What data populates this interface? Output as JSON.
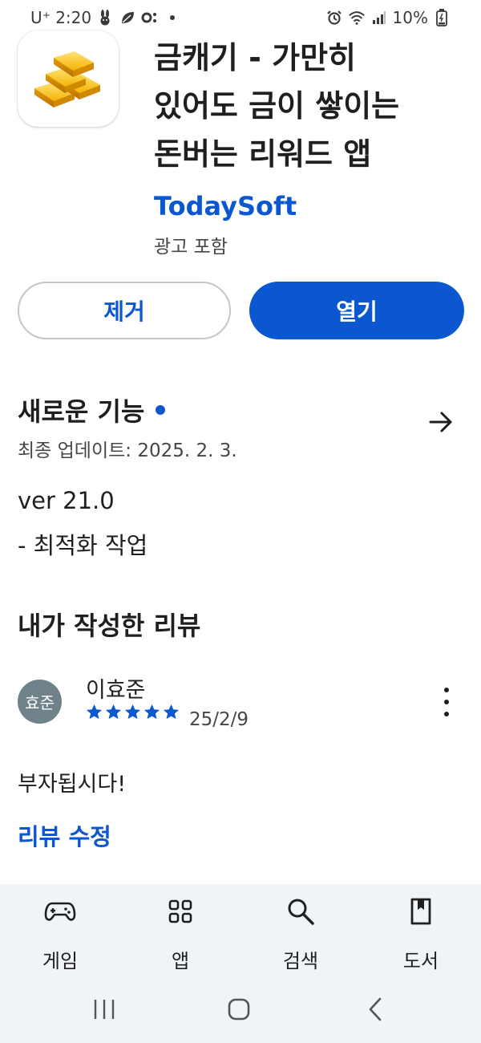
{
  "status_bar": {
    "carrier": "U⁺",
    "time": "2:20",
    "battery": "10%",
    "icons_left": [
      "rabbit-icon",
      "leaf-icon",
      "oo-icon",
      "dot-icon"
    ],
    "icons_right": [
      "alarm-icon",
      "wifi-icon",
      "signal-icon",
      "battery-icon"
    ]
  },
  "app": {
    "icon": "gold-bars-icon",
    "title_lines": [
      "금캐기 - 가만히",
      "있어도 금이 쌓이는",
      "돈버는 리워드 앱"
    ],
    "developer": "TodaySoft",
    "ads_notice": "광고 포함"
  },
  "actions": {
    "remove_label": "제거",
    "open_label": "열기"
  },
  "whats_new": {
    "title": "새로운 기능",
    "last_updated": "최종 업데이트: 2025. 2. 3.",
    "version": "ver 21.0",
    "note": "- 최적화 작업"
  },
  "my_review": {
    "section_title": "내가 작성한 리뷰",
    "avatar_text": "효준",
    "reviewer_name": "이효준",
    "rating": 5,
    "max_rating": 5,
    "date": "25/2/9",
    "text": "부자됩시다!",
    "edit_label": "리뷰 수정"
  },
  "bottom_nav": {
    "items": [
      {
        "label": "게임",
        "icon": "gamepad-icon"
      },
      {
        "label": "앱",
        "icon": "apps-grid-icon"
      },
      {
        "label": "검색",
        "icon": "search-icon"
      },
      {
        "label": "도서",
        "icon": "book-icon"
      }
    ]
  },
  "colors": {
    "accent": "#0b57d0",
    "nav_background": "#f0f4f9",
    "avatar_background": "#6f8189"
  }
}
